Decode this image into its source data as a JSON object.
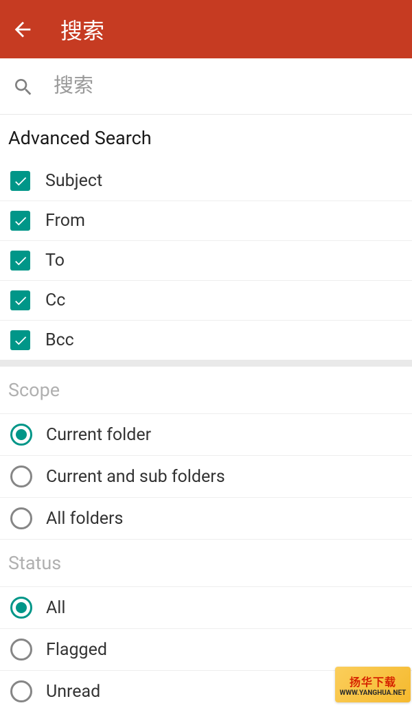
{
  "header": {
    "title": "搜索"
  },
  "search": {
    "placeholder": "搜索",
    "value": ""
  },
  "advanced": {
    "title": "Advanced Search",
    "items": [
      {
        "label": "Subject",
        "checked": true
      },
      {
        "label": "From",
        "checked": true
      },
      {
        "label": "To",
        "checked": true
      },
      {
        "label": "Cc",
        "checked": true
      },
      {
        "label": "Bcc",
        "checked": true
      }
    ]
  },
  "scope": {
    "title": "Scope",
    "items": [
      {
        "label": "Current folder",
        "selected": true
      },
      {
        "label": "Current and sub folders",
        "selected": false
      },
      {
        "label": "All folders",
        "selected": false
      }
    ]
  },
  "status": {
    "title": "Status",
    "items": [
      {
        "label": "All",
        "selected": true
      },
      {
        "label": "Flagged",
        "selected": false
      },
      {
        "label": "Unread",
        "selected": false
      }
    ]
  },
  "watermark": {
    "line1": "扬华下载",
    "line2": "WWW.YANGHUA.NET"
  }
}
